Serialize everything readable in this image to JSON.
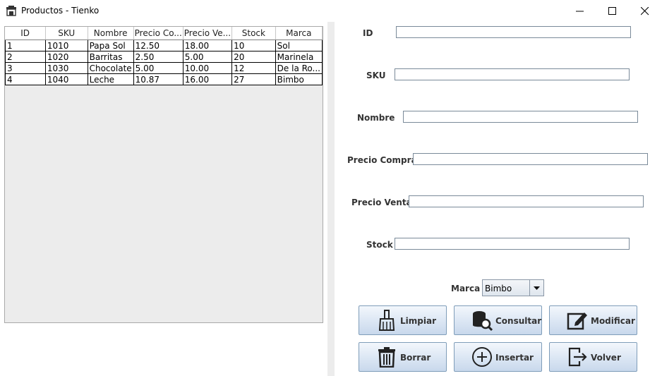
{
  "window": {
    "title": "Productos - Tienko",
    "icon": "store-icon"
  },
  "table": {
    "columns": [
      "ID",
      "SKU",
      "Nombre",
      "Precio Co...",
      "Precio Ve...",
      "Stock",
      "Marca"
    ],
    "rows": [
      [
        "1",
        "1010",
        "Papa Sol",
        "12.50",
        "18.00",
        "10",
        "Sol"
      ],
      [
        "2",
        "1020",
        "Barritas",
        "2.50",
        "5.00",
        "20",
        "Marinela"
      ],
      [
        "3",
        "1030",
        "Chocolate",
        "5.00",
        "10.00",
        "12",
        "De la Ro..."
      ],
      [
        "4",
        "1040",
        "Leche",
        "10.87",
        "16.00",
        "27",
        "Bimbo"
      ]
    ]
  },
  "form": {
    "id_label": "ID",
    "sku_label": "SKU",
    "nombre_label": "Nombre",
    "precio_compra_label": "Precio Compra",
    "precio_venta_label": "Precio Venta",
    "stock_label": "Stock",
    "marca_label": "Marca",
    "id_value": "",
    "sku_value": "",
    "nombre_value": "",
    "precio_compra_value": "",
    "precio_venta_value": "",
    "stock_value": "",
    "marca_selected": "Bimbo"
  },
  "buttons": {
    "limpiar": "Limpiar",
    "consultar": "Consultar",
    "modificar": "Modificar",
    "borrar": "Borrar",
    "insertar": "Insertar",
    "volver": "Volver"
  }
}
